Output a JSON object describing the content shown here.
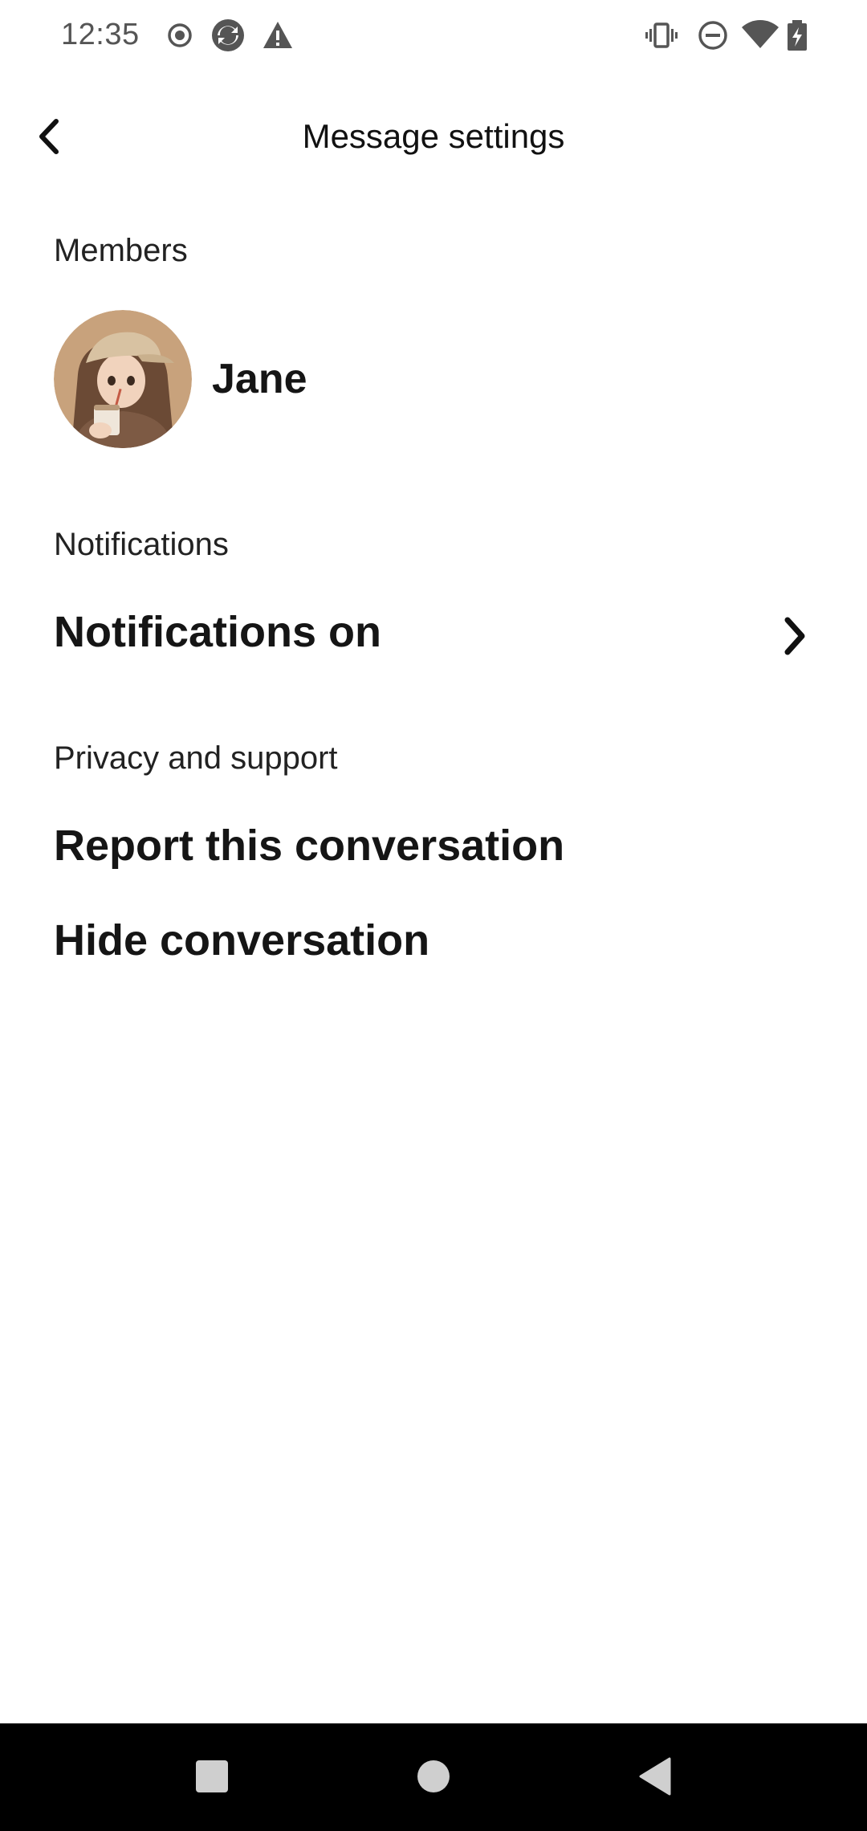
{
  "status_bar": {
    "time": "12:35",
    "left_icons": [
      "record-icon",
      "sync-app-icon",
      "warning-icon"
    ],
    "right_icons": [
      "vibrate-icon",
      "do-not-disturb-icon",
      "wifi-icon",
      "battery-charging-icon"
    ]
  },
  "header": {
    "title": "Message settings",
    "back_icon": "chevron-left-icon"
  },
  "members": {
    "label": "Members",
    "items": [
      {
        "name": "Jane",
        "avatar": "illustrated girl with cap holding cup"
      }
    ]
  },
  "notifications": {
    "label": "Notifications",
    "item_label": "Notifications on",
    "item_icon": "chevron-right-icon"
  },
  "privacy": {
    "label": "Privacy and support",
    "report_label": "Report this conversation",
    "hide_label": "Hide conversation"
  },
  "nav_bar": {
    "buttons": [
      "recents-square-icon",
      "home-circle-icon",
      "back-triangle-icon"
    ]
  },
  "colors": {
    "background": "#ffffff",
    "text": "#111111",
    "nav_bar": "#000000",
    "nav_icon": "#cfcfcf"
  }
}
